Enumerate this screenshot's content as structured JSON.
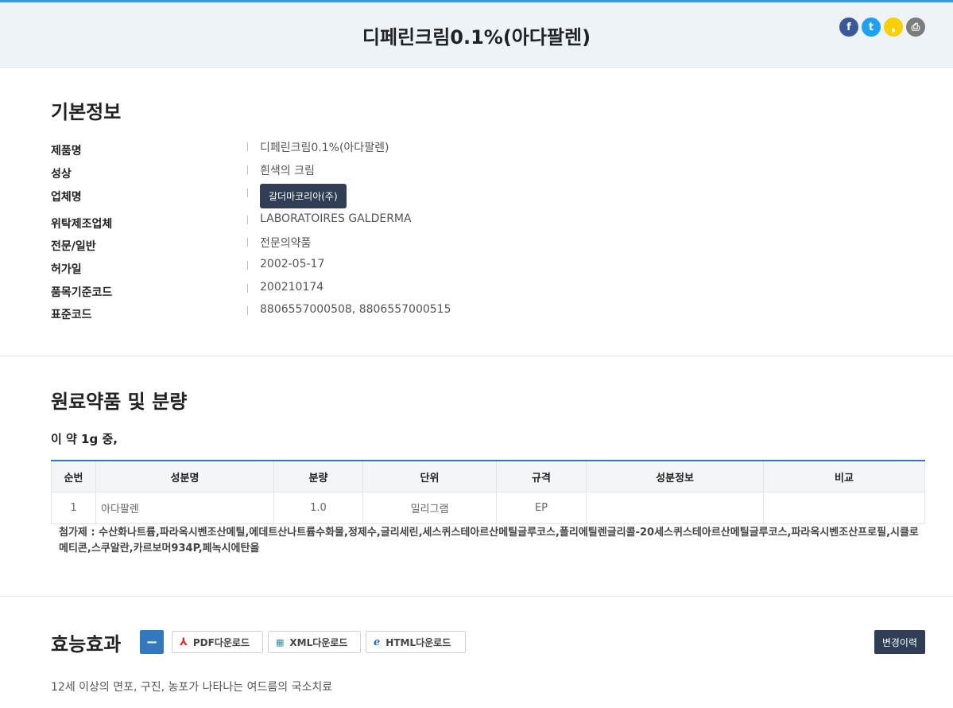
{
  "header": {
    "title": "디페린크림0.1%(아다팔렌)"
  },
  "sns": {
    "facebook": {
      "glyph": "f",
      "color": "#3b5998"
    },
    "twitter": {
      "glyph": "t",
      "color": "#1da1f2"
    },
    "kakao": {
      "glyph": "❟",
      "color": "#f9d000"
    },
    "print": {
      "glyph": "⎙",
      "color": "#7c7c7c"
    }
  },
  "basic": {
    "heading": "기본정보",
    "rows": [
      {
        "key": "제품명",
        "value": "디페린크림0.1%(아다팔렌)"
      },
      {
        "key": "성상",
        "value": "흰색의 크림"
      },
      {
        "key": "업체명",
        "value": "갈더마코리아(주)"
      },
      {
        "key": "위탁제조업체",
        "value": "LABORATOIRES GALDERMA"
      },
      {
        "key": "전문/일반",
        "value": "전문의약품"
      },
      {
        "key": "허가일",
        "value": "2002-05-17"
      },
      {
        "key": "품목기준코드",
        "value": "200210174"
      },
      {
        "key": "표준코드",
        "value": "8806557000508, 8806557000515"
      }
    ]
  },
  "ingredients": {
    "heading": "원료약품 및 분량",
    "subheading": "이 약 1g 중,",
    "columns": [
      "순번",
      "성분명",
      "분량",
      "단위",
      "규격",
      "성분정보",
      "비교"
    ],
    "rows": [
      [
        "1",
        "아다팔렌",
        "1.0",
        "밀리그램",
        "EP",
        "",
        ""
      ]
    ],
    "additives": "첨가제 : 수산화나트륨,파라옥시벤조산메틸,에데트산나트륨수화물,정제수,글리세린,세스퀴스테아르산메틸글루코스,폴리에틸렌글리콜-20세스퀴스테아르산메틸글루코스,파라옥시벤조산프로필,시클로메티콘,스쿠알란,카르보머934P,페녹시에탄올"
  },
  "efficacy": {
    "heading": "효능효과",
    "toggle": "−",
    "pdf_label": "PDF다운로드",
    "xml_label": "XML다운로드",
    "html_label": "HTML다운로드",
    "history_label": "변경이력",
    "text": "12세 이상의 면포, 구진, 농포가 나타나는 여드름의 국소치료"
  }
}
